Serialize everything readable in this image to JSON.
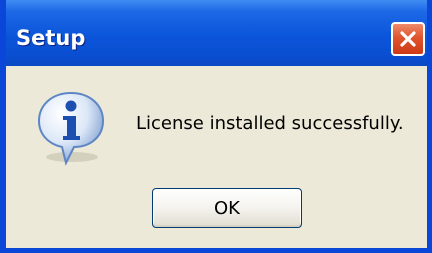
{
  "window": {
    "title": "Setup",
    "close_icon": "close-icon",
    "accent_color": "#0a46d8",
    "close_color": "#e0552e"
  },
  "dialog": {
    "icon": "info-icon",
    "message": "License installed successfully.",
    "ok_label": "OK"
  }
}
